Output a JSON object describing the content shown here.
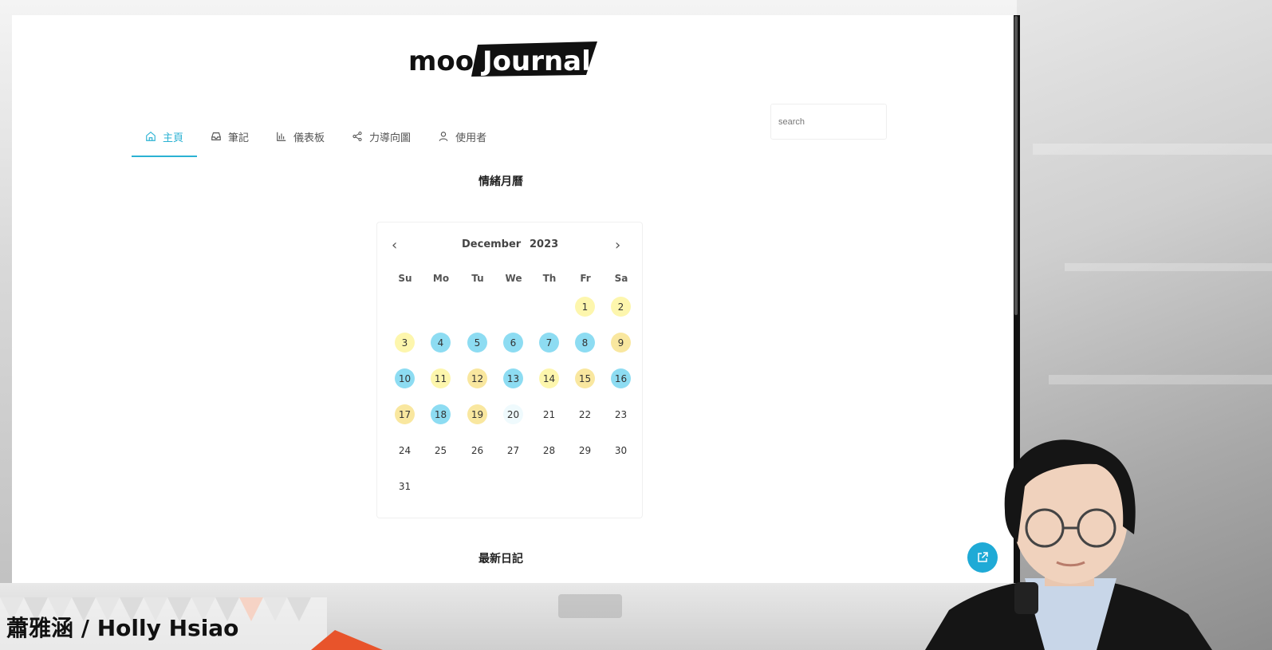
{
  "app": {
    "logo_text": "moodJournal."
  },
  "nav": {
    "items": [
      {
        "label": "主頁",
        "icon": "home-icon",
        "active": true
      },
      {
        "label": "筆記",
        "icon": "inbox-icon",
        "active": false
      },
      {
        "label": "儀表板",
        "icon": "bar-chart-icon",
        "active": false
      },
      {
        "label": "力導向圖",
        "icon": "share-nodes-icon",
        "active": false
      },
      {
        "label": "使用者",
        "icon": "user-icon",
        "active": false
      }
    ]
  },
  "search": {
    "placeholder": "search"
  },
  "mood_calendar": {
    "title": "情緒月曆",
    "month": "December",
    "year": "2023",
    "weekdays": [
      "Su",
      "Mo",
      "Tu",
      "We",
      "Th",
      "Fr",
      "Sa"
    ],
    "first_weekday_index": 5,
    "days_in_month": 31,
    "today": 20,
    "mood_colors": {
      "yellow": "#fdf6ad",
      "amber": "#f9e79f",
      "blue": "#8ddcf2",
      "today": "#effafd"
    },
    "marked_days": {
      "1": "yellow",
      "2": "yellow",
      "3": "yellow",
      "4": "blue",
      "5": "blue",
      "6": "blue",
      "7": "blue",
      "8": "blue",
      "9": "amber",
      "10": "blue",
      "11": "yellow",
      "12": "amber",
      "13": "blue",
      "14": "yellow",
      "15": "amber",
      "16": "blue",
      "17": "amber",
      "18": "blue",
      "19": "amber",
      "20": "today"
    }
  },
  "latest_journal": {
    "title": "最新日記"
  },
  "overlay": {
    "speaker_name": "蕭雅涵 / Holly Hsiao"
  },
  "colors": {
    "accent": "#2bb2d3",
    "fab": "#1faad6"
  }
}
